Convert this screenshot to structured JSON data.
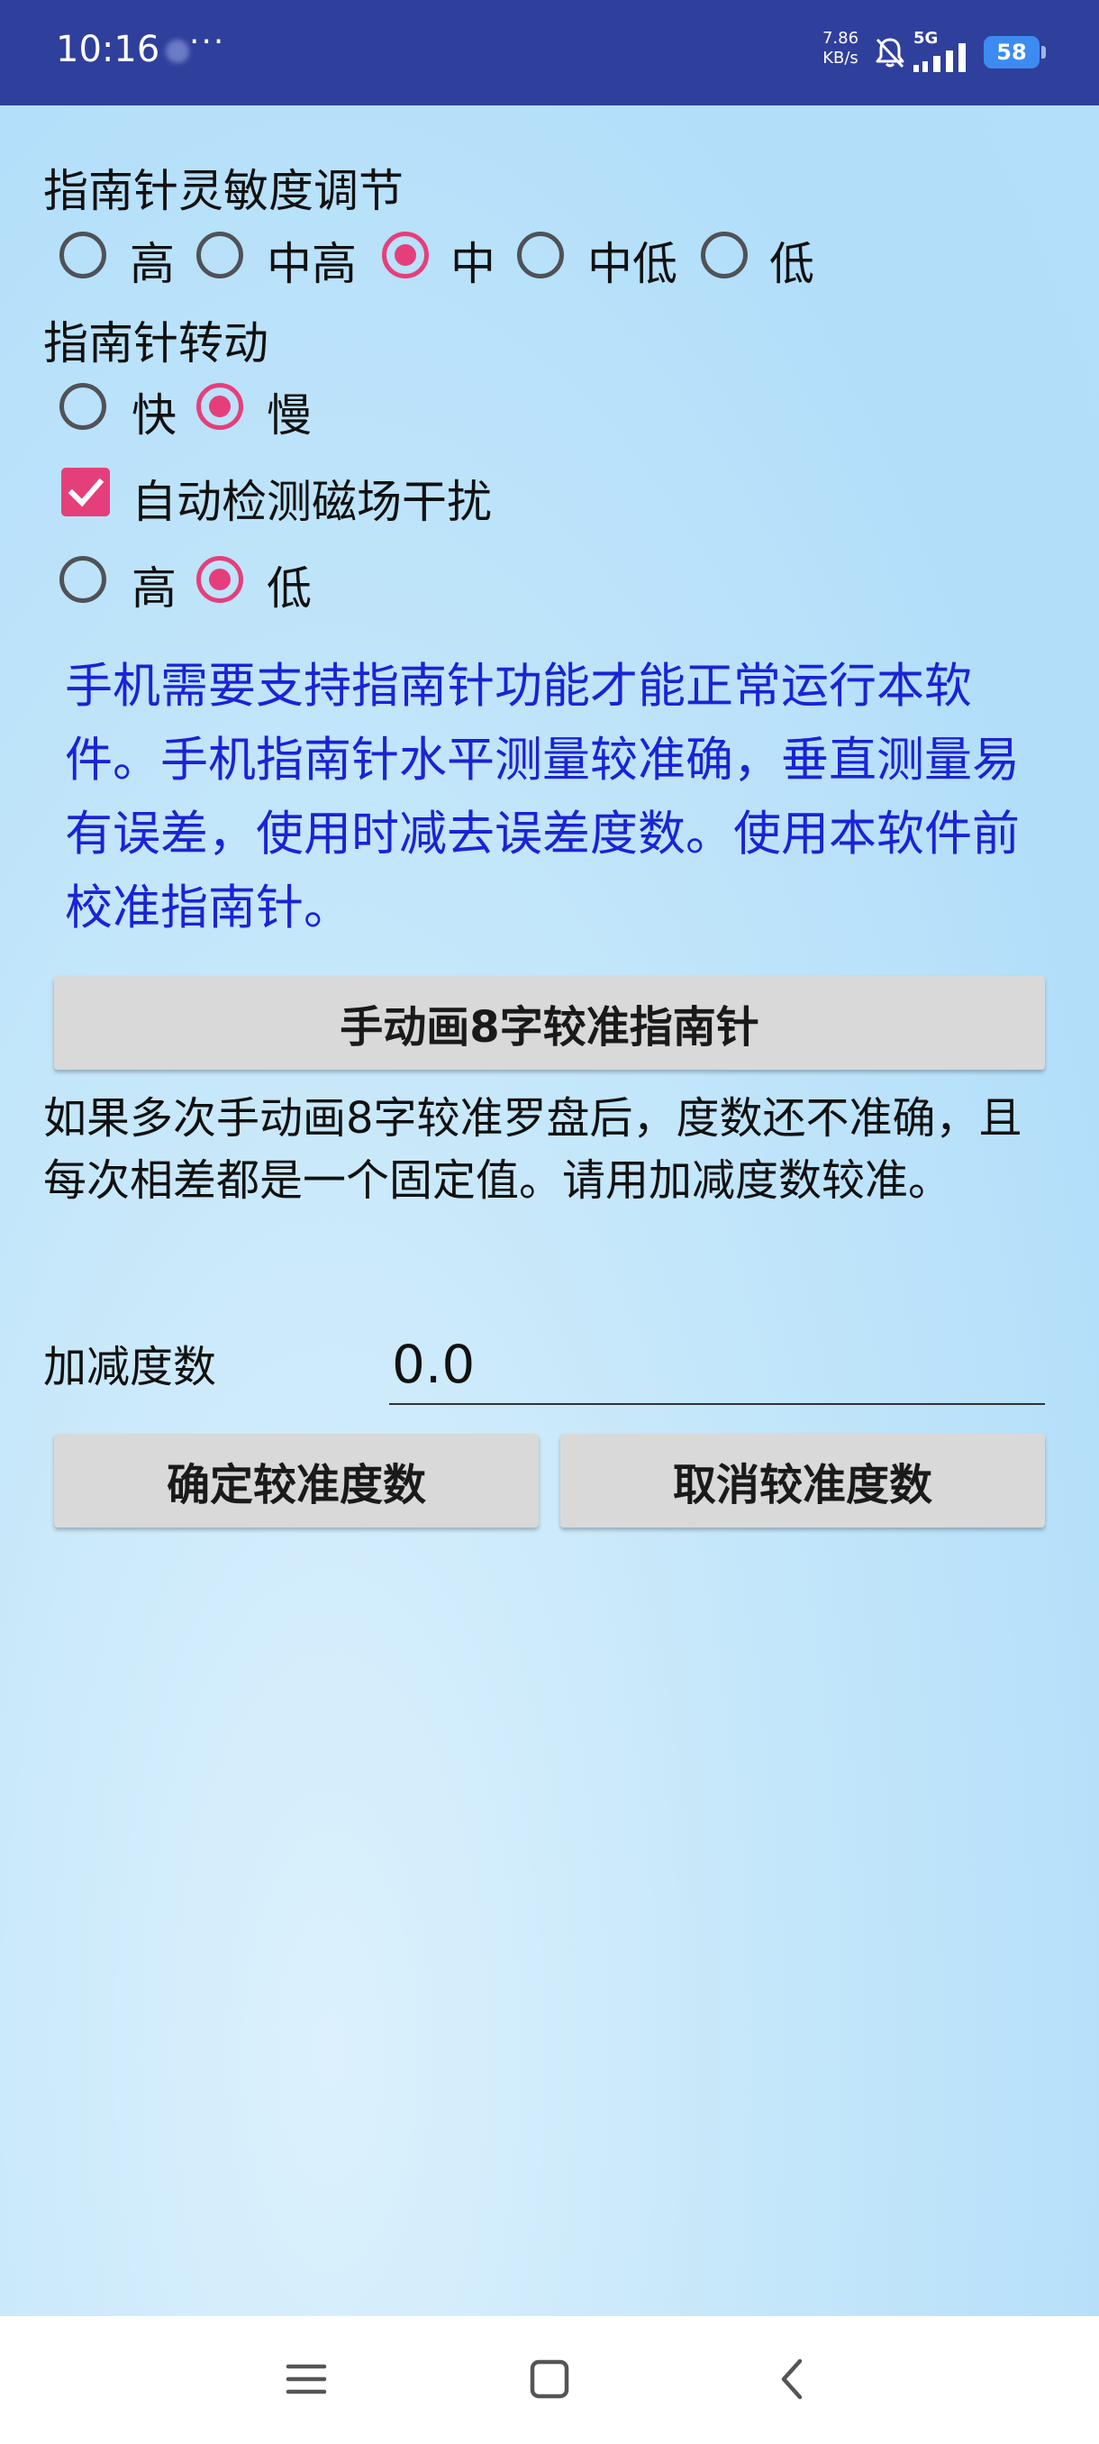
{
  "status": {
    "time": "10:16",
    "dots": "···",
    "speed_value": "7.86",
    "speed_unit": "KB/s",
    "network": "5G",
    "battery": "58"
  },
  "sensitivity": {
    "label": "指南针灵敏度调节",
    "options": [
      "高",
      "中高",
      "中",
      "中低",
      "低"
    ],
    "selected": "中"
  },
  "rotation": {
    "label": "指南针转动",
    "options": [
      "快",
      "慢"
    ],
    "selected": "慢"
  },
  "magnetic": {
    "checkbox_label": "自动检测磁场干扰",
    "checked": true,
    "options": [
      "高",
      "低"
    ],
    "selected": "低"
  },
  "info_text": "手机需要支持指南针功能才能正常运行本软件。手机指南针水平测量较准确，垂直测量易有误差，使用时减去误差度数。使用本软件前校准指南针。",
  "calibrate_button": "手动画8字较准指南针",
  "description": "如果多次手动画8字较准罗盘后，度数还不准确，且每次相差都是一个固定值。请用加减度数较准。",
  "offset": {
    "label": "加减度数",
    "value": "0.0"
  },
  "confirm_button": "确定较准度数",
  "cancel_button": "取消较准度数",
  "colors": {
    "status_bar": "#2f3f9c",
    "accent": "#e53f7b",
    "info_text": "#1a23d6"
  }
}
